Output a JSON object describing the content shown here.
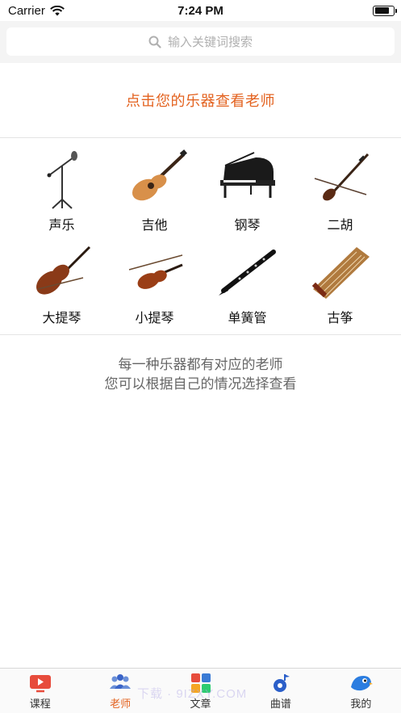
{
  "status": {
    "carrier": "Carrier",
    "time": "7:24 PM"
  },
  "search": {
    "placeholder": "输入关键词搜索"
  },
  "headline": "点击您的乐器查看老师",
  "instruments": [
    {
      "label": "声乐",
      "icon": "microphone-stand-icon"
    },
    {
      "label": "吉他",
      "icon": "guitar-icon"
    },
    {
      "label": "钢琴",
      "icon": "grand-piano-icon"
    },
    {
      "label": "二胡",
      "icon": "erhu-icon"
    },
    {
      "label": "大提琴",
      "icon": "cello-icon"
    },
    {
      "label": "小提琴",
      "icon": "violin-icon"
    },
    {
      "label": "单簧管",
      "icon": "clarinet-icon"
    },
    {
      "label": "古筝",
      "icon": "guzheng-icon"
    }
  ],
  "info": {
    "line1": "每一种乐器都有对应的老师",
    "line2": "您可以根据自己的情况选择查看"
  },
  "tabs": [
    {
      "label": "课程",
      "icon": "video-course-icon",
      "active": false
    },
    {
      "label": "老师",
      "icon": "teachers-icon",
      "active": true
    },
    {
      "label": "文章",
      "icon": "articles-grid-icon",
      "active": false
    },
    {
      "label": "曲谱",
      "icon": "music-score-icon",
      "active": false
    },
    {
      "label": "我的",
      "icon": "profile-bird-icon",
      "active": false
    }
  ],
  "watermark": "下载 · 9IZXY.COM",
  "colors": {
    "accent": "#e3621f",
    "divider": "#e4e4e4",
    "search_bg": "#f4f4f4"
  }
}
